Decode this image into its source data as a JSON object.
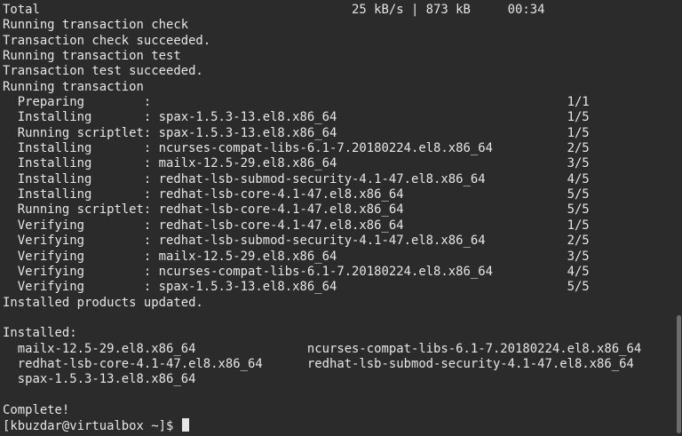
{
  "terminal": {
    "lines": [
      "Total                                          25 kB/s | 873 kB     00:34",
      "Running transaction check",
      "Transaction check succeeded.",
      "Running transaction test",
      "Transaction test succeeded.",
      "Running transaction",
      "  Preparing        :                                                        1/1",
      "  Installing       : spax-1.5.3-13.el8.x86_64                               1/5",
      "  Running scriptlet: spax-1.5.3-13.el8.x86_64                               1/5",
      "  Installing       : ncurses-compat-libs-6.1-7.20180224.el8.x86_64          2/5",
      "  Installing       : mailx-12.5-29.el8.x86_64                               3/5",
      "  Installing       : redhat-lsb-submod-security-4.1-47.el8.x86_64           4/5",
      "  Installing       : redhat-lsb-core-4.1-47.el8.x86_64                      5/5",
      "  Running scriptlet: redhat-lsb-core-4.1-47.el8.x86_64                      5/5",
      "  Verifying        : redhat-lsb-core-4.1-47.el8.x86_64                      1/5",
      "  Verifying        : redhat-lsb-submod-security-4.1-47.el8.x86_64           2/5",
      "  Verifying        : mailx-12.5-29.el8.x86_64                               3/5",
      "  Verifying        : ncurses-compat-libs-6.1-7.20180224.el8.x86_64          4/5",
      "  Verifying        : spax-1.5.3-13.el8.x86_64                               5/5",
      "Installed products updated.",
      "",
      "Installed:",
      "  mailx-12.5-29.el8.x86_64               ncurses-compat-libs-6.1-7.20180224.el8.x86_64",
      "  redhat-lsb-core-4.1-47.el8.x86_64      redhat-lsb-submod-security-4.1-47.el8.x86_64",
      "  spax-1.5.3-13.el8.x86_64",
      "",
      "Complete!"
    ],
    "prompt": "[kbuzdar@virtualbox ~]$ "
  }
}
